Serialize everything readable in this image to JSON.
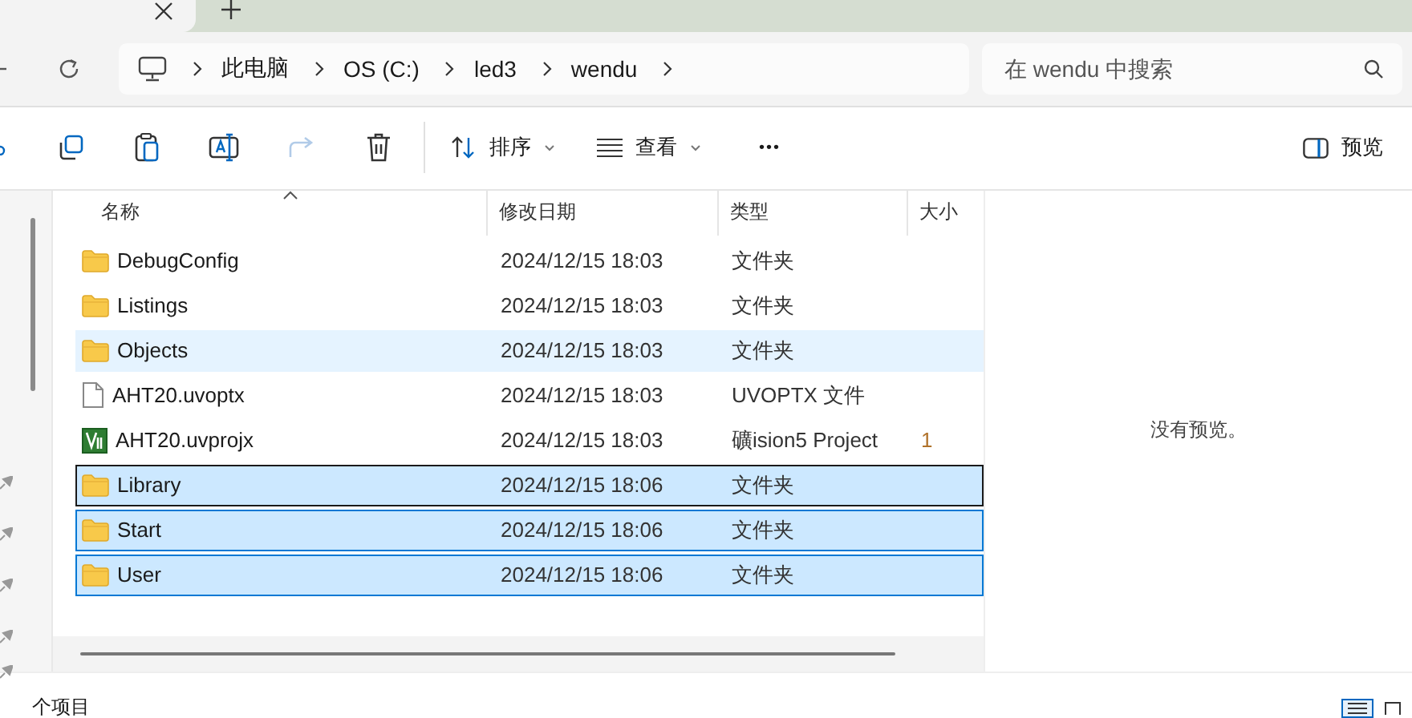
{
  "breadcrumbs": [
    "此电脑",
    "OS (C:)",
    "led3",
    "wendu"
  ],
  "search": {
    "placeholder": "在 wendu 中搜索"
  },
  "toolbar": {
    "buttons": [
      {
        "kind": "copy",
        "disabled": false
      },
      {
        "kind": "paste",
        "disabled": false
      },
      {
        "kind": "rename",
        "disabled": false
      },
      {
        "kind": "share",
        "disabled": true
      },
      {
        "kind": "delete",
        "disabled": false
      }
    ],
    "sort": "排序",
    "view": "查看",
    "more": "•••",
    "preview": "预览"
  },
  "columns": [
    "名称",
    "修改日期",
    "类型",
    "大小"
  ],
  "rows": [
    {
      "kind": "folder",
      "name": "DebugConfig",
      "date": "2024/12/15 18:03",
      "type": "文件夹",
      "size": "",
      "hovered": false,
      "selected": false,
      "focused": false
    },
    {
      "kind": "folder",
      "name": "Listings",
      "date": "2024/12/15 18:03",
      "type": "文件夹",
      "size": "",
      "hovered": false,
      "selected": false,
      "focused": false
    },
    {
      "kind": "folder",
      "name": "Objects",
      "date": "2024/12/15 18:03",
      "type": "文件夹",
      "size": "",
      "hovered": true,
      "selected": false,
      "focused": false
    },
    {
      "kind": "file",
      "name": "AHT20.uvoptx",
      "date": "2024/12/15 18:03",
      "type": "UVOPTX 文件",
      "size": "",
      "hovered": false,
      "selected": false,
      "focused": false
    },
    {
      "kind": "project",
      "name": "AHT20.uvprojx",
      "date": "2024/12/15 18:03",
      "type": "礦ision5 Project",
      "size": "1",
      "hovered": false,
      "selected": false,
      "focused": false
    },
    {
      "kind": "folder",
      "name": "Library",
      "date": "2024/12/15 18:06",
      "type": "文件夹",
      "size": "",
      "hovered": false,
      "selected": true,
      "focused": true
    },
    {
      "kind": "folder",
      "name": "Start",
      "date": "2024/12/15 18:06",
      "type": "文件夹",
      "size": "",
      "hovered": false,
      "selected": true,
      "focused": false
    },
    {
      "kind": "folder",
      "name": "User",
      "date": "2024/12/15 18:06",
      "type": "文件夹",
      "size": "",
      "hovered": false,
      "selected": true,
      "focused": false
    }
  ],
  "preview_pane": {
    "message": "没有预览。"
  },
  "status_bar": {
    "count": "个项目",
    "views": [
      {
        "kind": "details",
        "selected": true
      },
      {
        "kind": "tiles",
        "selected": false
      }
    ]
  }
}
